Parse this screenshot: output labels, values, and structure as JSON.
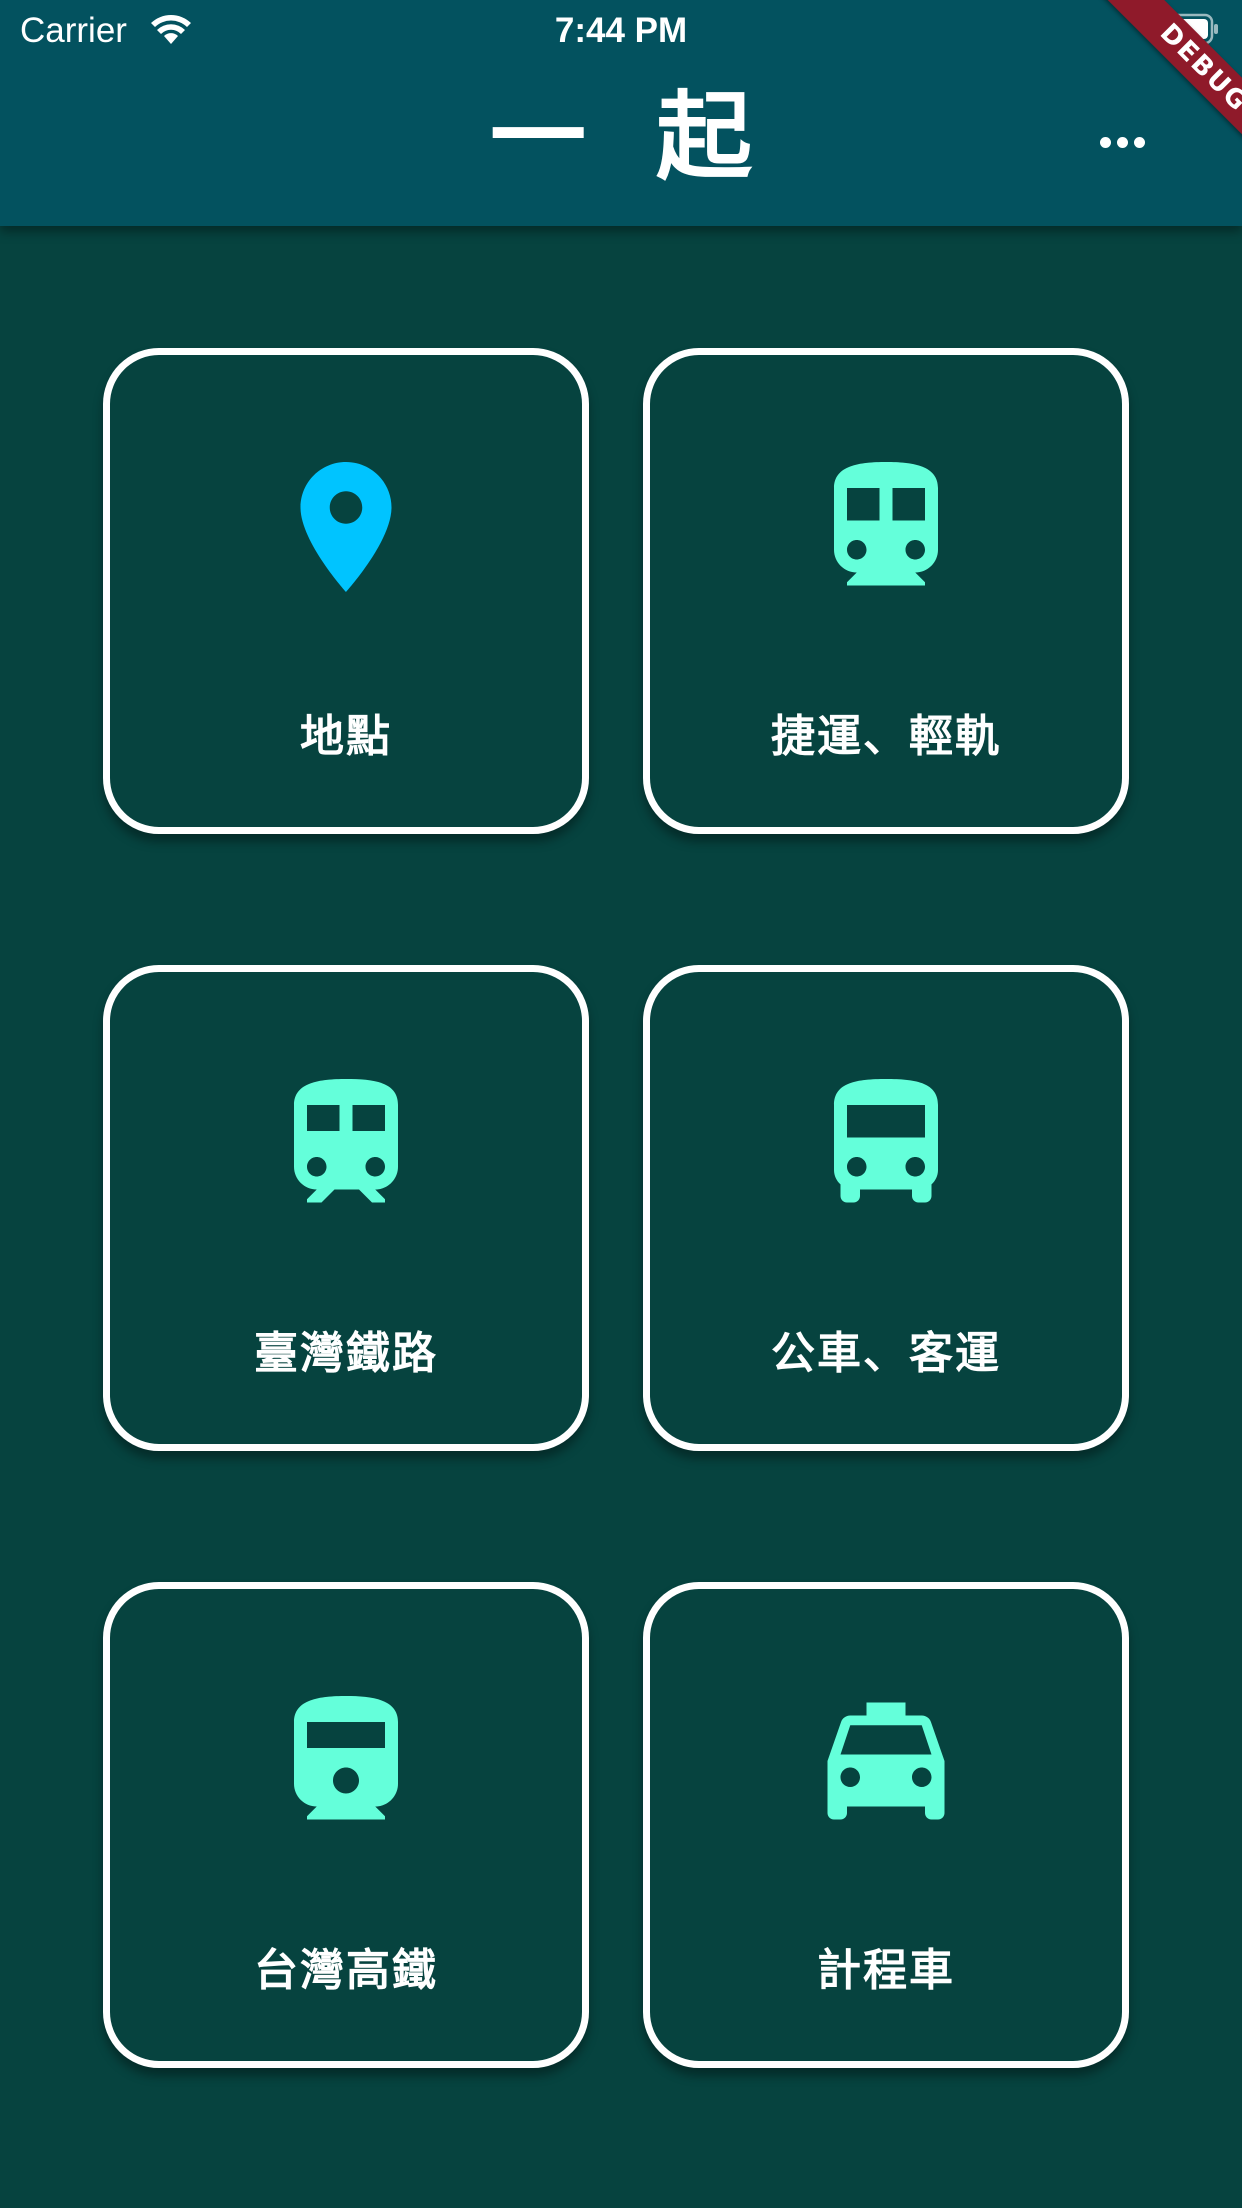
{
  "status_bar": {
    "carrier": "Carrier",
    "time": "7:44 PM"
  },
  "app_bar": {
    "title": "一起",
    "debug_banner": "DEBUG",
    "more_icon": "more-horizontal-icon"
  },
  "colors": {
    "app_bar_background": "#03525f",
    "page_background": "#06433f",
    "tile_border": "#ffffff",
    "icon_mint": "#64ffda",
    "icon_location": "#00c4ff",
    "debug_banner": "#8f1a2a"
  },
  "tiles": [
    {
      "label": "地點",
      "icon": "location-pin-icon"
    },
    {
      "label": "捷運、輕軌",
      "icon": "subway-icon"
    },
    {
      "label": "臺灣鐵路",
      "icon": "train-icon"
    },
    {
      "label": "公車、客運",
      "icon": "bus-icon"
    },
    {
      "label": "台灣高鐵",
      "icon": "high-speed-rail-icon"
    },
    {
      "label": "計程車",
      "icon": "taxi-icon"
    }
  ]
}
